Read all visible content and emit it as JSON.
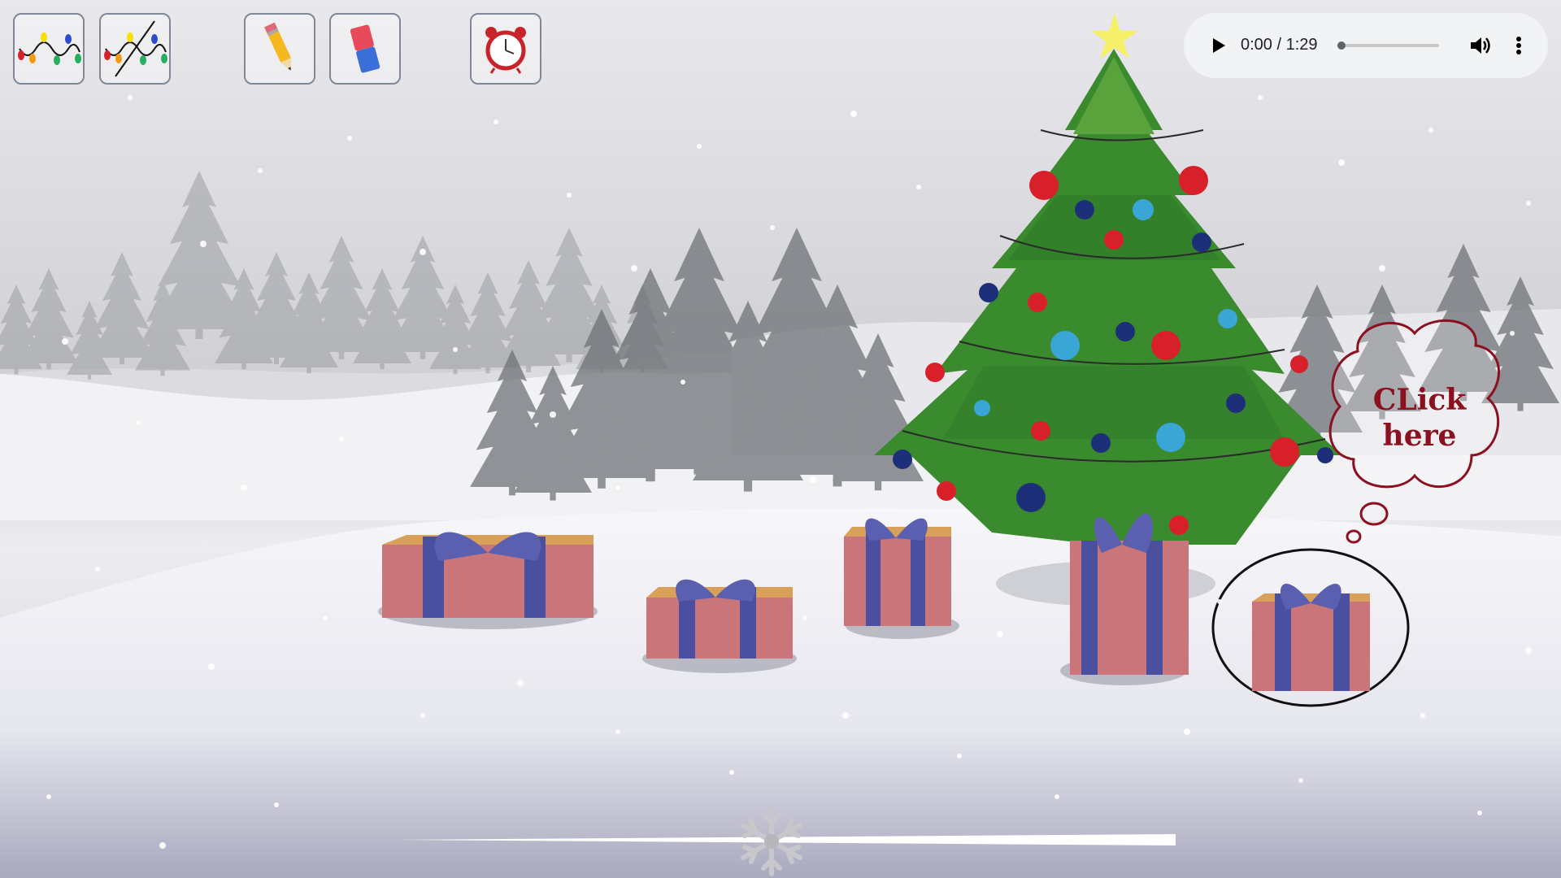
{
  "toolbar": {
    "buttons": [
      {
        "name": "lights-on",
        "icon": "christmas-lights-icon"
      },
      {
        "name": "lights-off",
        "icon": "christmas-lights-crossed-icon"
      },
      {
        "name": "pencil",
        "icon": "pencil-icon"
      },
      {
        "name": "eraser",
        "icon": "eraser-icon"
      },
      {
        "name": "timer",
        "icon": "alarm-clock-icon"
      }
    ]
  },
  "audio_player": {
    "time_display": "0:00 / 1:29",
    "play_icon": "play-icon",
    "volume_icon": "volume-icon",
    "more_icon": "more-options-icon",
    "progress": 0
  },
  "callout": {
    "line1": "CLick",
    "line2": "here"
  },
  "slider": {
    "thumb_icon": "snowflake-icon",
    "value": 0.5
  },
  "colors": {
    "callout_text": "#8b1020",
    "callout_outline": "#8b1020",
    "gift_box": "#c9757a",
    "gift_ribbon": "#4b4fa0",
    "tree_green": "#3a8a2e"
  }
}
